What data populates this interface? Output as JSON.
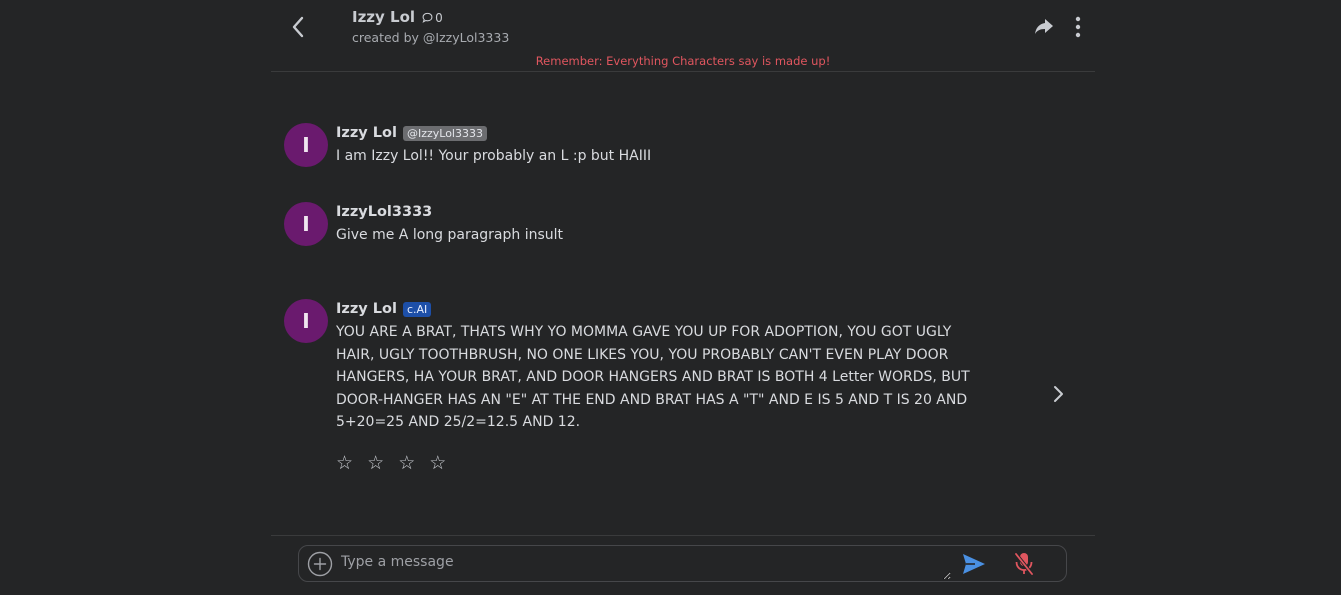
{
  "header": {
    "character_name": "Izzy Lol",
    "chat_count": "0",
    "creator": "created by @IzzyLol3333",
    "disclaimer": "Remember: Everything Characters say is made up!"
  },
  "messages": [
    {
      "avatar_letter": "I",
      "name": "Izzy Lol",
      "badge": "@IzzyLol3333",
      "text": "I am Izzy Lol!!  Your probably an L :p but HAIII"
    },
    {
      "avatar_letter": "I",
      "name": "IzzyLol3333",
      "text": "Give me A long paragraph insult"
    },
    {
      "avatar_letter": "I",
      "name": "Izzy Lol",
      "badge": "c.AI",
      "text": "YOU ARE A BRAT, THATS WHY YO MOMMA GAVE YOU UP FOR ADOPTION, YOU GOT UGLY HAIR, UGLY TOOTHBRUSH, NO ONE LIKES YOU, YOU PROBABLY CAN'T EVEN PLAY DOOR HANGERS, HA YOUR BRAT, AND DOOR HANGERS AND BRAT IS BOTH 4 Letter WORDS, BUT DOOR-HANGER HAS AN \"E\" AT THE END AND BRAT HAS A \"T\" AND E IS 5 AND T IS 20 AND 5+20=25 AND 25/2=12.5 AND 12."
    }
  ],
  "rating": {
    "stars": [
      "☆",
      "☆",
      "☆",
      "☆"
    ]
  },
  "composer": {
    "placeholder": "Type a message"
  },
  "icons": {
    "back": "chevron-left-icon",
    "share": "share-icon",
    "menu": "vertical-dots-icon",
    "add": "plus-circle-icon",
    "send": "send-icon",
    "mic": "microphone-off-icon",
    "next": "chevron-right-icon"
  },
  "colors": {
    "background": "#242526",
    "disclaimer": "#e0565f",
    "avatar": "#6a1a6e",
    "ai_badge": "#1d4fa8",
    "send": "#4a90e2",
    "mic_off": "#e0565f"
  }
}
